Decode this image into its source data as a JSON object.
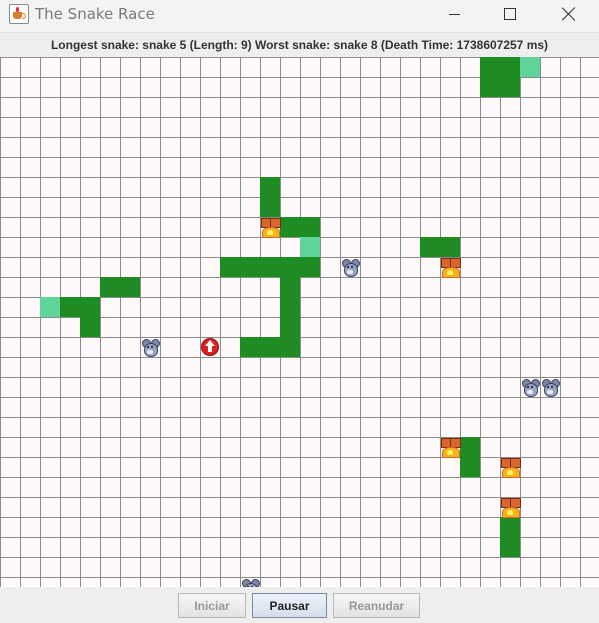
{
  "window": {
    "title": "The Snake Race",
    "icon": "java-cup-icon"
  },
  "status": {
    "text": "Longest snake: snake 5 (Length: 9)  Worst snake: snake 8 (Death Time: 1738607257 ms)"
  },
  "board": {
    "columns": 30,
    "rows": 27,
    "grid_color": "#8b8b8b",
    "background_color": "#fffafa",
    "snake_color": "#1e8c22",
    "snake_head_color": "#5fd39a",
    "snakes": [
      {
        "cells": [
          [
            25,
            0
          ],
          [
            24,
            0
          ],
          [
            25,
            1
          ],
          [
            24,
            1
          ]
        ],
        "head": [
          26,
          0
        ]
      },
      {
        "cells": [
          [
            13,
            6
          ],
          [
            13,
            7
          ],
          [
            14,
            8
          ],
          [
            15,
            8
          ],
          [
            11,
            10
          ],
          [
            12,
            10
          ],
          [
            13,
            10
          ],
          [
            14,
            10
          ],
          [
            15,
            10
          ],
          [
            14,
            11
          ],
          [
            14,
            12
          ],
          [
            14,
            13
          ],
          [
            12,
            14
          ],
          [
            13,
            14
          ],
          [
            14,
            14
          ]
        ],
        "head": [
          15,
          9
        ]
      },
      {
        "cells": [
          [
            21,
            9
          ],
          [
            22,
            9
          ]
        ]
      },
      {
        "cells": [
          [
            5,
            11
          ],
          [
            6,
            11
          ],
          [
            4,
            12
          ],
          [
            3,
            12
          ],
          [
            4,
            13
          ]
        ],
        "head": [
          2,
          12
        ]
      },
      {
        "cells": [
          [
            23,
            19
          ],
          [
            23,
            20
          ]
        ]
      },
      {
        "cells": [
          [
            25,
            23
          ],
          [
            25,
            24
          ]
        ]
      }
    ],
    "mice": [
      [
        17,
        10
      ],
      [
        7,
        14
      ],
      [
        26,
        16
      ],
      [
        27,
        16
      ],
      [
        12,
        26
      ]
    ],
    "fire_traps": [
      [
        13,
        8
      ],
      [
        22,
        10
      ],
      [
        22,
        19
      ],
      [
        25,
        20
      ],
      [
        25,
        22
      ]
    ],
    "turbo_boosts": [
      [
        10,
        14
      ]
    ]
  },
  "controls": [
    {
      "label": "Iniciar",
      "enabled": false
    },
    {
      "label": "Pausar",
      "enabled": true
    },
    {
      "label": "Reanudar",
      "enabled": false
    }
  ]
}
